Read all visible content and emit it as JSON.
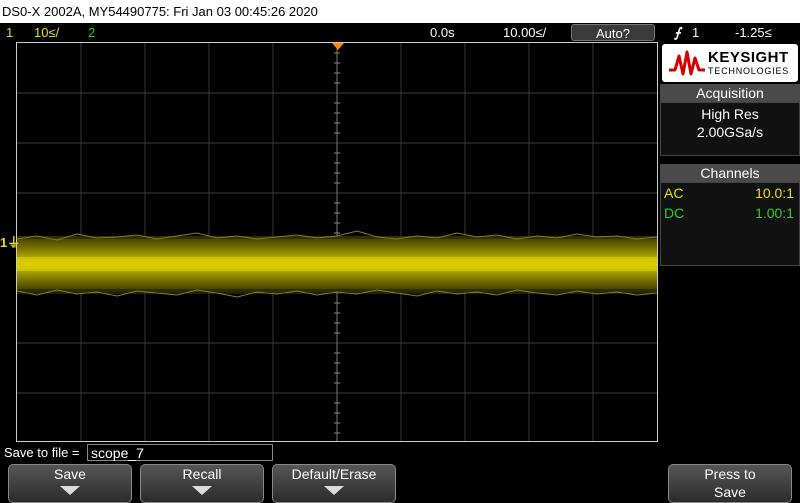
{
  "titlebar": {
    "text": "DS0-X 2002A, MY54490775: Fri Jan 03 00:45:26 2020"
  },
  "status": {
    "ch1_num": "1",
    "ch1_scale": "10≤/",
    "ch2_num": "2",
    "delay": "0.0s",
    "timebase": "10.00≤/",
    "trigger_mode": "Auto?",
    "trigger_channel": "1",
    "trigger_level": "-1.25≤"
  },
  "logo": {
    "brand": "KEYSIGHT",
    "sub": "TECHNOLOGIES"
  },
  "acquisition": {
    "header": "Acquisition",
    "mode": "High Res",
    "rate": "2.00GSa/s"
  },
  "channels": {
    "header": "Channels",
    "rows": [
      {
        "coupling": "AC",
        "probe": "10.0:1",
        "color": "#e8e000"
      },
      {
        "coupling": "DC",
        "probe": "1.00:1",
        "color": "#2ecc2e"
      }
    ]
  },
  "save": {
    "label": "Save to file =",
    "filename": "scope_7"
  },
  "softkeys": {
    "save": "Save",
    "recall": "Recall",
    "default_erase": "Default/Erase",
    "press_line1": "Press to",
    "press_line2": "Save"
  },
  "colors": {
    "ch1": "#e8e000",
    "ch2": "#2ecc2e",
    "trigger_marker": "#ff8a00"
  }
}
